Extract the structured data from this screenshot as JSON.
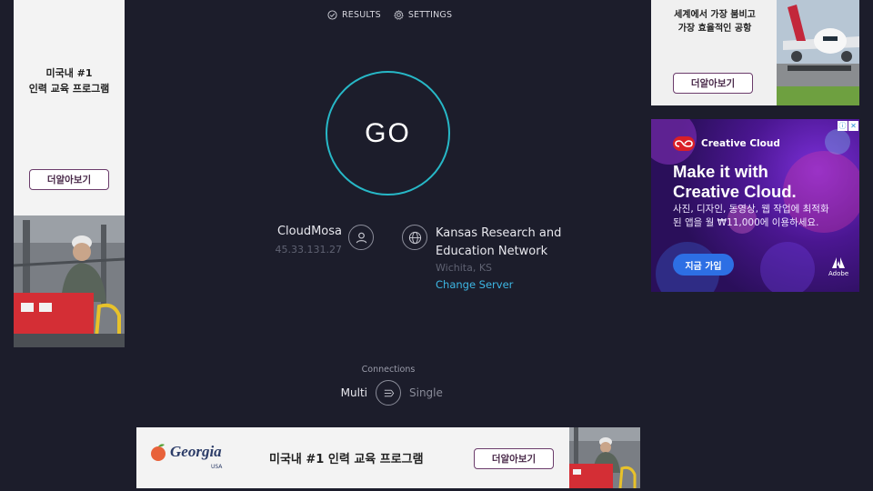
{
  "nav": {
    "results_label": "RESULTS",
    "settings_label": "SETTINGS"
  },
  "go_label": "GO",
  "isp": {
    "name": "CloudMosa",
    "ip": "45.33.131.27"
  },
  "server": {
    "name": "Kansas Research and Education Network",
    "location": "Wichita, KS",
    "change_label": "Change Server"
  },
  "connections": {
    "label": "Connections",
    "multi_label": "Multi",
    "single_label": "Single",
    "selected": "Multi"
  },
  "ads": {
    "left": {
      "text_line1": "미국내 #1",
      "text_line2": "인력 교육 프로그램",
      "button_label": "더알아보기"
    },
    "top_right": {
      "text_line1": "세계에서 가장 붐비고",
      "text_line2": "가장 효율적인 공항",
      "button_label": "더알아보기"
    },
    "creative_cloud": {
      "brand": "Creative Cloud",
      "headline_line1": "Make it with",
      "headline_line2": "Creative Cloud.",
      "subtext": "사진, 디자인, 동영상, 웹 작업에 최적화된 앱을 월 ₩11,000에 이용하세요.",
      "cta_label": "지금 가입",
      "adobe_label": "Adobe"
    },
    "bottom": {
      "logo_text": "Georgia",
      "logo_sub": "USA",
      "text": "미국내 #1 인력 교육 프로그램",
      "button_label": "더알아보기"
    }
  },
  "colors": {
    "background": "#1c1d2b",
    "go_ring": "#27b8c7",
    "link": "#3db7e4",
    "adobe_red": "#da1f26",
    "cc_purple": "#4a1690"
  }
}
